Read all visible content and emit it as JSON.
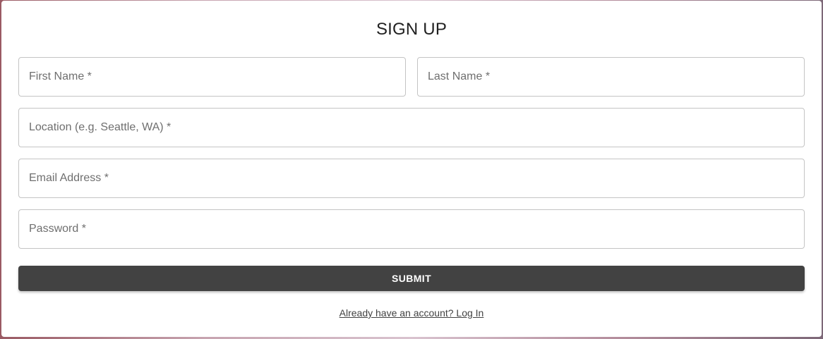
{
  "form": {
    "title": "SIGN UP",
    "fields": {
      "first_name": {
        "placeholder": "First Name *",
        "value": ""
      },
      "last_name": {
        "placeholder": "Last Name *",
        "value": ""
      },
      "location": {
        "placeholder": "Location (e.g. Seattle, WA) *",
        "value": ""
      },
      "email": {
        "placeholder": "Email Address *",
        "value": ""
      },
      "password": {
        "placeholder": "Password *",
        "value": ""
      }
    },
    "submit_label": "SUBMIT",
    "login_link_label": "Already have an account? Log In"
  },
  "colors": {
    "button_bg": "#424242",
    "button_text": "#ffffff",
    "field_border": "#c4c4c4",
    "placeholder": "#6f6f6f"
  }
}
